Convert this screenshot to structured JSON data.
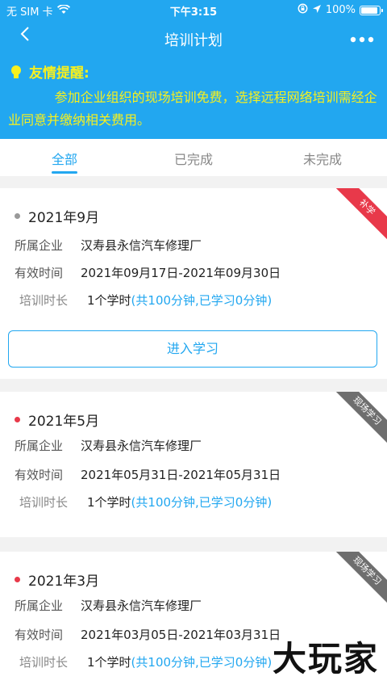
{
  "status_bar": {
    "carrier": "无 SIM 卡",
    "time": "下午3:15",
    "battery": "100%",
    "battery_level": 1.0
  },
  "nav": {
    "back_icon": "chevron-left-icon",
    "title": "培训计划",
    "more_label": "•••"
  },
  "notice": {
    "title": "友情提醒:",
    "body": "参加企业组织的现场培训免费，选择远程网络培训需经企业同意并缴纳相关费用。"
  },
  "tabs": [
    {
      "label": "全部",
      "active": true
    },
    {
      "label": "已完成",
      "active": false
    },
    {
      "label": "未完成",
      "active": false
    }
  ],
  "labels": {
    "company": "所属企业",
    "valid_time": "有效时间",
    "duration": "培训时长",
    "enter": "进入学习"
  },
  "plans": [
    {
      "month": "2021年9月",
      "dot_color": "#999999",
      "ribbon": "补学",
      "company": "汉寿县永信汽车修理厂",
      "period": "2021年09月17日-2021年09月30日",
      "hours": "1个学时",
      "progress": "(共100分钟,已学习0分钟)"
    },
    {
      "month": "2021年5月",
      "dot_color": "#e8394a",
      "ribbon": "现场学习",
      "company": "汉寿县永信汽车修理厂",
      "period": "2021年05月31日-2021年05月31日",
      "hours": "1个学时",
      "progress": "(共100分钟,已学习0分钟)"
    },
    {
      "month": "2021年3月",
      "dot_color": "#e8394a",
      "ribbon": "现场学习",
      "company": "汉寿县永信汽车修理厂",
      "period": "2021年03月05日-2021年03月31日",
      "hours": "1个学时",
      "progress": "(共100分钟,已学习0分钟)"
    }
  ],
  "watermark": "大玩家",
  "colors": {
    "primary": "#22a7f0",
    "notice_text": "#f7f01e",
    "ribbon_red": "#e8394a",
    "ribbon_gray": "#6e6e6e"
  }
}
